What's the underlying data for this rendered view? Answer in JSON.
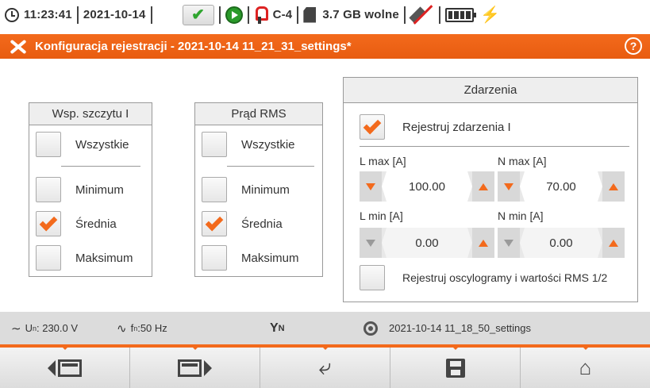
{
  "status": {
    "time": "11:23:41",
    "date": "2021-10-14",
    "clamp": "C-4",
    "storage": "3.7 GB wolne"
  },
  "title": "Konfiguracja rejestracji - 2021-10-14 11_21_31_settings*",
  "crest_panel": {
    "header": "Wsp. szczytu I",
    "items": [
      {
        "label": "Wszystkie",
        "checked": false
      },
      {
        "label": "Minimum",
        "checked": false
      },
      {
        "label": "Średnia",
        "checked": true
      },
      {
        "label": "Maksimum",
        "checked": false
      }
    ]
  },
  "rms_panel": {
    "header": "Prąd RMS",
    "items": [
      {
        "label": "Wszystkie",
        "checked": false
      },
      {
        "label": "Minimum",
        "checked": false
      },
      {
        "label": "Średnia",
        "checked": true
      },
      {
        "label": "Maksimum",
        "checked": false
      }
    ]
  },
  "events_panel": {
    "header": "Zdarzenia",
    "register_events": {
      "label": "Rejestruj zdarzenia I",
      "checked": true
    },
    "l_max": {
      "label": "L max [A]",
      "value": "100.00"
    },
    "n_max": {
      "label": "N max [A]",
      "value": "70.00"
    },
    "l_min": {
      "label": "L min [A]",
      "value": "0.00"
    },
    "n_min": {
      "label": "N min [A]",
      "value": "0.00"
    },
    "register_osc": {
      "label": "Rejestruj oscylogramy i wartości RMS 1/2",
      "checked": false
    }
  },
  "infobar": {
    "un_prefix": "U",
    "un_sub": "n",
    "un_value": ": 230.0 V",
    "fn_prefix": "f",
    "fn_sub": "n",
    "fn_value": ":50 Hz",
    "network_sub": "N",
    "settings_file": "2021-10-14 11_18_50_settings"
  },
  "colors": {
    "accent": "#f36a1c",
    "ok": "#2fa52f"
  }
}
